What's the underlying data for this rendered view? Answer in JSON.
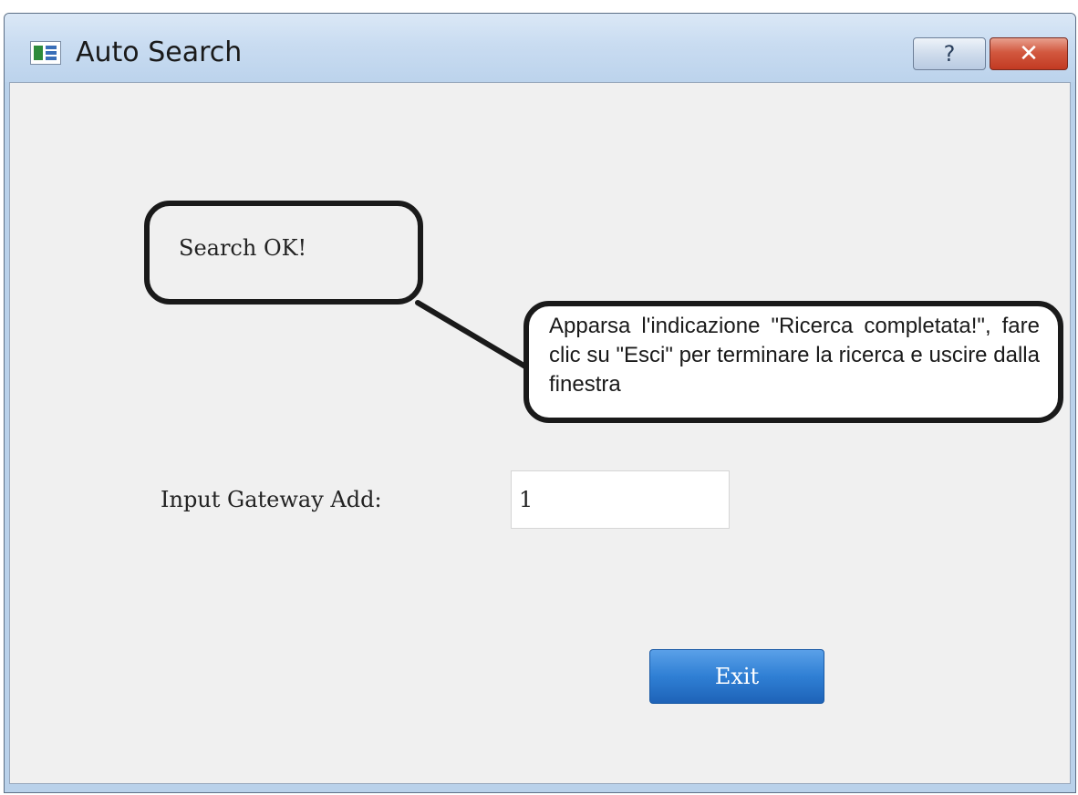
{
  "window": {
    "title": "Auto Search",
    "help_label": "?",
    "close_label": "✕"
  },
  "dialog": {
    "status": "Search OK!",
    "gateway_label": "Input Gateway Add:",
    "gateway_value": "1",
    "exit_label": "Exit"
  },
  "annotation": {
    "text": "Apparsa l'indicazione \"Ricerca completata!\", fare clic su \"Esci\" per terminare la ricerca e uscire dalla finestra"
  },
  "colors": {
    "exit_button": "#2f7fd4",
    "close_button": "#c23a22",
    "client_background": "#f0f0f0"
  }
}
